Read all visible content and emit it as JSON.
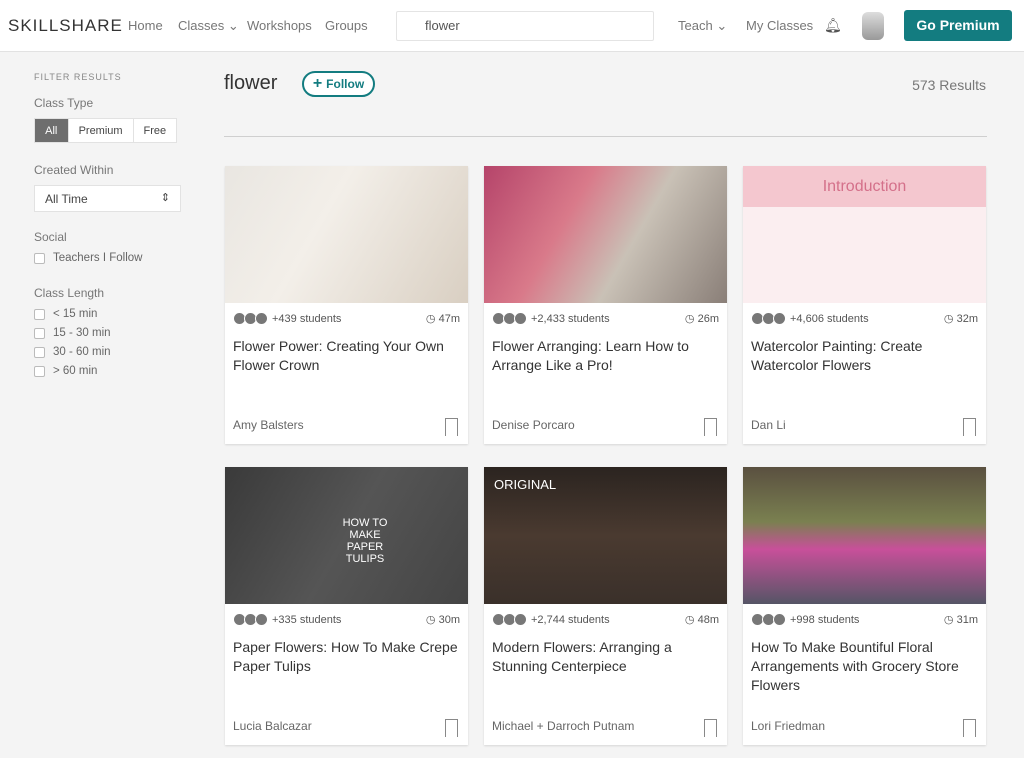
{
  "header": {
    "logo": "SKILLSHARE",
    "nav": [
      "Home",
      "Classes",
      "Workshops",
      "Groups"
    ],
    "search_value": "flower",
    "teach": "Teach",
    "my_classes": "My Classes",
    "premium": "Go Premium"
  },
  "sidebar": {
    "heading": "FILTER RESULTS",
    "class_type": "Class Type",
    "types": [
      "All",
      "Premium",
      "Free"
    ],
    "created": "Created Within",
    "created_value": "All Time",
    "social": "Social",
    "social_opt": "Teachers I Follow",
    "length": "Class Length",
    "lengths": [
      "< 15 min",
      "15 - 30 min",
      "30 - 60 min",
      "> 60 min"
    ]
  },
  "main": {
    "query": "flower",
    "follow": "Follow",
    "results": "573 Results",
    "cards": [
      {
        "students": "+439 students",
        "duration": "47m",
        "title": "Flower Power: Creating Your Own Flower Crown",
        "author": "Amy Balsters",
        "badge": ""
      },
      {
        "students": "+2,433 students",
        "duration": "26m",
        "title": "Flower Arranging: Learn How to Arrange Like a Pro!",
        "author": "Denise Porcaro",
        "badge": ""
      },
      {
        "students": "+4,606 students",
        "duration": "32m",
        "title": "Watercolor Painting: Create Watercolor Flowers",
        "author": "Dan Li",
        "badge": "Introduction"
      },
      {
        "students": "+335 students",
        "duration": "30m",
        "title": "Paper Flowers: How To Make Crepe Paper Tulips",
        "author": "Lucia Balcazar",
        "badge": "HOW TO MAKE PAPER TULIPS"
      },
      {
        "students": "+2,744 students",
        "duration": "48m",
        "title": "Modern Flowers: Arranging a Stunning Centerpiece",
        "author": "Michael + Darroch Putnam",
        "badge": "ORIGINAL"
      },
      {
        "students": "+998 students",
        "duration": "31m",
        "title": "How To Make Bountiful Floral Arrangements with Grocery Store Flowers",
        "author": "Lori Friedman",
        "badge": ""
      }
    ]
  }
}
